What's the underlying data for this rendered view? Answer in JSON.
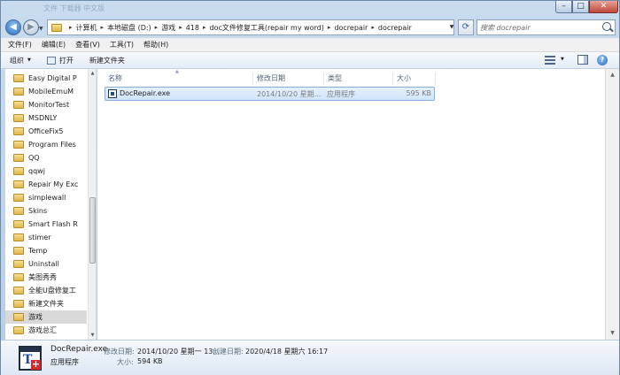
{
  "window": {
    "title_ghost": "文件 下载器 中文版",
    "controls": {
      "minimize": "–",
      "maximize": "□",
      "close": "✕"
    }
  },
  "address": {
    "segments": [
      "计算机",
      "本地磁盘 (D:)",
      "游戏",
      "418",
      "doc文件修复工具(repair my word)",
      "docrepair",
      "docrepair"
    ],
    "search_placeholder": "搜索 docrepair"
  },
  "menu": [
    "文件(F)",
    "编辑(E)",
    "查看(V)",
    "工具(T)",
    "帮助(H)"
  ],
  "toolbar": {
    "organize": "组织",
    "open": "打开",
    "new_folder": "新建文件夹"
  },
  "tree": [
    "Easy Digital P",
    "MobileEmuM",
    "MonitorTest",
    "MSDNLY",
    "OfficeFix5",
    "Program Files",
    "QQ",
    "qqwj",
    "Repair My Exc",
    "simplewall",
    "Skins",
    "Smart Flash R",
    "stimer",
    "Temp",
    "Uninstall",
    "美图秀秀",
    "全能U盘修复工",
    "新建文件夹",
    "游戏",
    "游戏总汇"
  ],
  "tree_selected_index": 18,
  "columns": {
    "name": "名称",
    "modified": "修改日期",
    "type": "类型",
    "size": "大小"
  },
  "files": [
    {
      "name": "DocRepair.exe",
      "modified": "2014/10/20 星期...",
      "type": "应用程序",
      "size": "595 KB"
    }
  ],
  "details": {
    "file_name": "DocRepair.exe",
    "modified_label": "修改日期:",
    "modified_value": "2014/10/20 星期一 13...",
    "created_label": "创建日期:",
    "created_value": "2020/4/18 星期六 16:17",
    "type_value": "应用程序",
    "size_label": "大小:",
    "size_value": "594 KB"
  },
  "icons": {
    "back": "back-arrow-icon",
    "forward": "forward-arrow-icon",
    "refresh": "refresh-icon",
    "search": "search-icon",
    "folder": "folder-icon",
    "exe": "exe-file-icon",
    "help": "help-icon"
  },
  "colors": {
    "frame": "#b7cde6",
    "selection": "#cfe4fa",
    "selection_border": "#84acdd",
    "close_button": "#c0463a"
  }
}
